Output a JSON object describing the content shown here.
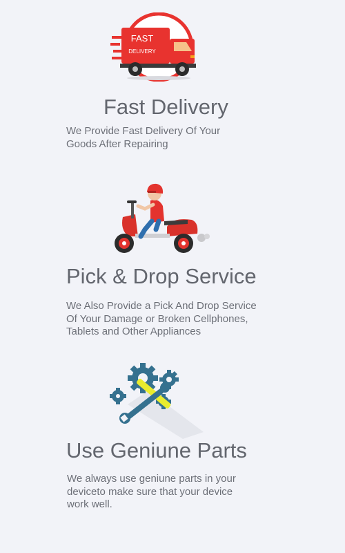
{
  "features": [
    {
      "icon": "fast-delivery-truck-icon",
      "badge_line1": "FAST",
      "badge_line2": "DELIVERY",
      "title": "Fast Delivery",
      "description": "We Provide Fast Delivery Of Your\nGoods After Repairing"
    },
    {
      "icon": "scooter-rider-icon",
      "title": "Pick & Drop Service",
      "description": "We Also Provide a Pick And Drop Service\nOf Your Damage or Broken Cellphones,\nTablets and Other Appliances"
    },
    {
      "icon": "gears-wrench-icon",
      "title": "Use Geniune Parts",
      "description": "We always use geniune parts in your\ndeviceto make sure that your device\nwork well."
    }
  ],
  "colors": {
    "background": "#f2f3f8",
    "accent_red": "#e8332f",
    "gear_blue": "#35718f",
    "wrench_yellow": "#e9ec2e",
    "text": "#63666e"
  }
}
